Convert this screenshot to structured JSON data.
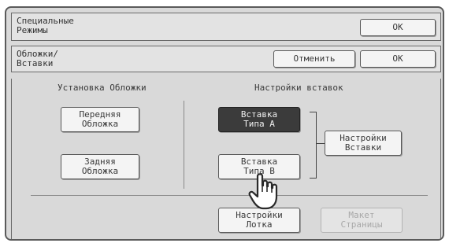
{
  "header": {
    "title": "Специальные\nРежимы",
    "ok_label": "OK"
  },
  "subheader": {
    "title": "Обложки/\nВставки",
    "cancel_label": "Отменить",
    "ok_label": "OK"
  },
  "covers": {
    "heading": "Установка Обложки",
    "front_label": "Передняя\nОбложка",
    "back_label": "Задняя\nОбложка"
  },
  "inserts": {
    "heading": "Настройки вставок",
    "type_a_label": "Вставка\nТипа A",
    "type_b_label": "Вставка\nТипа B",
    "settings_label": "Настройки\nВставки",
    "selected": "type_a"
  },
  "bottom": {
    "tray_label": "Настройки\nЛотка",
    "layout_label": "Макет\nСтраницы",
    "layout_enabled": false
  },
  "icons": {
    "pointer": "hand-pointer-icon"
  },
  "colors": {
    "frame_bg": "#d9d9d9",
    "selected_bg": "#3b3b3b"
  }
}
